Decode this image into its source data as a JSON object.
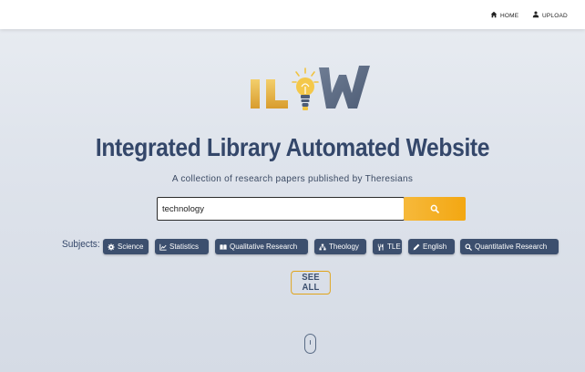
{
  "nav": {
    "home_label": "HOME",
    "upload_label": "UPLOAD",
    "home_icon": "home-icon",
    "upload_icon": "upload-icon"
  },
  "logo": {
    "text": "ILW",
    "icon": "lightbulb-icon",
    "colors": {
      "gold": "#e7b84b",
      "slate": "#5e6d86"
    }
  },
  "hero": {
    "title": "Integrated Library Automated Website",
    "subtitle": "A collection of research papers published by Theresians"
  },
  "search": {
    "value": "technology",
    "button_icon": "search-icon",
    "button_color": "#f5ad28"
  },
  "subjects": {
    "label": "Subjects:",
    "items": [
      {
        "label": "Science",
        "icon": "gear-icon"
      },
      {
        "label": "Statistics",
        "icon": "chart-line-icon"
      },
      {
        "label": "Qualitative Research",
        "icon": "book-open-icon"
      },
      {
        "label": "Theology",
        "icon": "sitemap-icon"
      },
      {
        "label": "TLE",
        "icon": "utensils-icon"
      },
      {
        "label": "English",
        "icon": "pen-icon"
      },
      {
        "label": "Quantitative Research",
        "icon": "search-icon"
      }
    ]
  },
  "see_all": {
    "label": "SEE ALL"
  },
  "colors": {
    "primary": "#34476a",
    "chip": "#3c4f6e",
    "accent": "#f5ad28"
  }
}
